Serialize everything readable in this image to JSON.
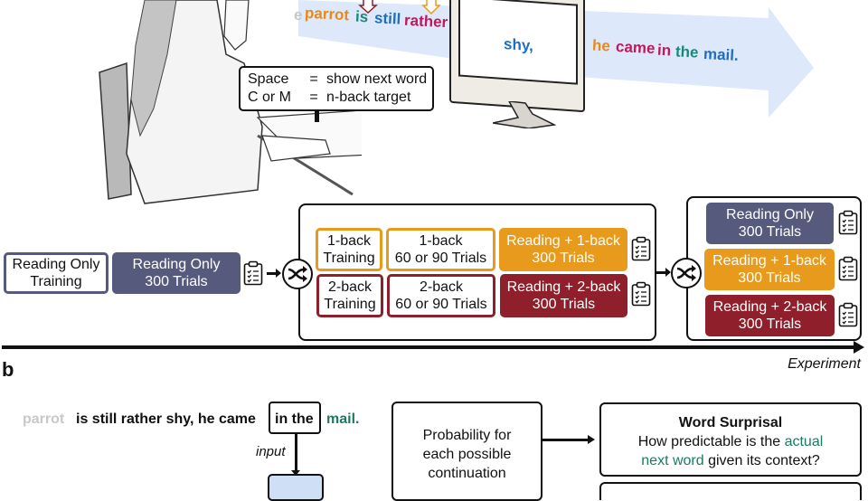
{
  "panel_a": {
    "reading_stream": {
      "words_before_screen": [
        {
          "text": "e",
          "color": "#c8c8c8"
        },
        {
          "text": "parrot",
          "color": "#e88a1a"
        },
        {
          "text": "is",
          "color": "#168a7a"
        },
        {
          "text": "still",
          "color": "#1e6fc0"
        },
        {
          "text": "rather",
          "color": "#c0185e"
        }
      ],
      "screen_word": {
        "text": "shy,",
        "color": "#1e6fc0"
      },
      "words_after_screen": [
        {
          "text": "he",
          "color": "#e88a1a"
        },
        {
          "text": "came",
          "color": "#c0185e"
        },
        {
          "text": "in",
          "color": "#c0185e"
        },
        {
          "text": "the",
          "color": "#168a7a"
        },
        {
          "text": "mail.",
          "color": "#1e6fc0"
        }
      ],
      "arrow_color": "#dde8fa",
      "nback_arrow_colors": [
        "#8e1f2b",
        "#e79a1b"
      ]
    },
    "key_legend": {
      "rows": [
        {
          "key": "Space",
          "eq": "=",
          "action": "show next word"
        },
        {
          "key": "C or M",
          "eq": "=",
          "action": "n-back target"
        }
      ]
    },
    "timeline": {
      "stage1": [
        {
          "line1": "Reading Only",
          "line2": "Training",
          "style": "outline-purple"
        },
        {
          "line1": "Reading Only",
          "line2": "300 Trials",
          "style": "fill-purple"
        }
      ],
      "stage2": {
        "row_1back": [
          {
            "line1": "1-back",
            "line2": "Training",
            "style": "outline-orange"
          },
          {
            "line1": "1-back",
            "line2": "60 or 90 Trials",
            "style": "outline-orange"
          },
          {
            "line1": "Reading + 1-back",
            "line2": "300 Trials",
            "style": "fill-orange"
          }
        ],
        "row_2back": [
          {
            "line1": "2-back",
            "line2": "Training",
            "style": "outline-red"
          },
          {
            "line1": "2-back",
            "line2": "60 or 90 Trials",
            "style": "outline-red"
          },
          {
            "line1": "Reading + 2-back",
            "line2": "300 Trials",
            "style": "fill-red"
          }
        ]
      },
      "stage3": [
        {
          "line1": "Reading Only",
          "line2": "300 Trials",
          "style": "fill-purple"
        },
        {
          "line1": "Reading + 1-back",
          "line2": "300 Trials",
          "style": "fill-orange"
        },
        {
          "line1": "Reading + 2-back",
          "line2": "300 Trials",
          "style": "fill-red"
        }
      ],
      "axis_label": "Experiment",
      "icons": {
        "questionnaire": "clipboard-icon",
        "randomize": "shuffle-icon"
      }
    }
  },
  "panel_b": {
    "label": "b",
    "sentence": {
      "faded": "parrot",
      "context": "is still rather shy, he came",
      "window": "in the",
      "target": "mail.",
      "target_color": "#1a7a62"
    },
    "input_label": "input",
    "probability_box": {
      "lines": [
        "Probability for",
        "each possible",
        "continuation"
      ]
    },
    "surprisal_box": {
      "title": "Word Surprisal",
      "text_1": "How predictable is the ",
      "highlight_1": "actual",
      "highlight_2": "next word",
      "text_2": " given its context?",
      "highlight_color": "#1a7a62"
    }
  }
}
